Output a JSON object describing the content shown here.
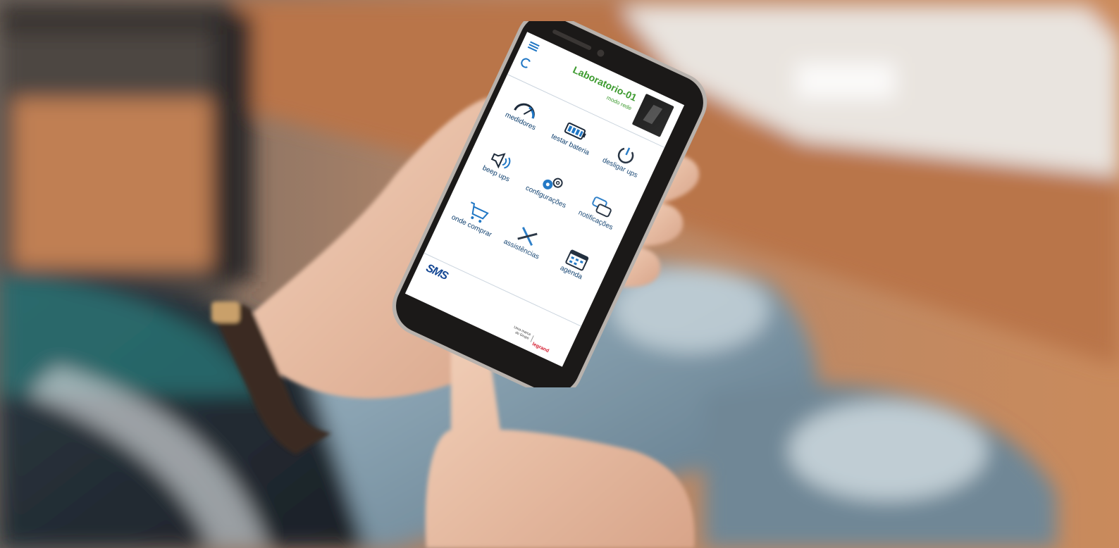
{
  "app": {
    "device_name": "Laboratorio-01",
    "device_subtitle": "modo rede",
    "brand": "SMS",
    "footer_tagline_line1": "Uma marca",
    "footer_tagline_line2": "do Grupo",
    "partner_brand": "legrand"
  },
  "menu": [
    {
      "label": "medidores",
      "icon": "gauge-icon"
    },
    {
      "label": "testar bateria",
      "icon": "battery-icon"
    },
    {
      "label": "desligar ups",
      "icon": "power-icon"
    },
    {
      "label": "beep ups",
      "icon": "speaker-icon"
    },
    {
      "label": "configurações",
      "icon": "gears-icon"
    },
    {
      "label": "notificações",
      "icon": "chat-bubbles-icon"
    },
    {
      "label": "onde comprar",
      "icon": "cart-icon"
    },
    {
      "label": "assistências",
      "icon": "tools-icon"
    },
    {
      "label": "agenda",
      "icon": "calendar-icon"
    }
  ],
  "colors": {
    "title_green": "#3c9a2e",
    "icon_blue": "#1f76c4",
    "icon_dark": "#1d2a3a",
    "brand_blue": "#0a3f8f",
    "legrand_red": "#d3182b",
    "wood": "#b7774d"
  }
}
